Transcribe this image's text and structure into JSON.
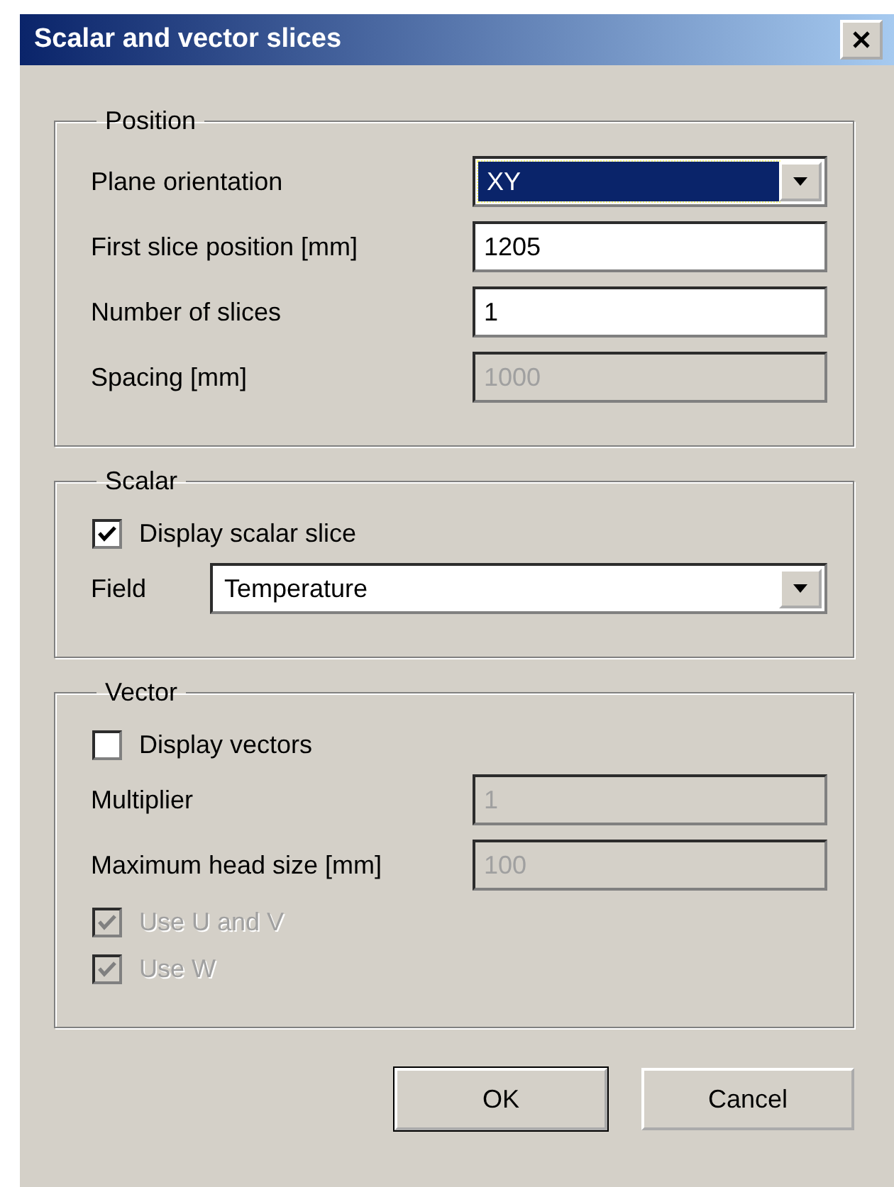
{
  "window": {
    "title": "Scalar and vector slices"
  },
  "sections": [
    {
      "title": "Position",
      "rows": [
        {
          "kind": "combo",
          "label": "Plane orientation",
          "value": "XY",
          "focused": true
        },
        {
          "kind": "field",
          "label": "First slice position [mm]",
          "value": "1205",
          "disabled": false
        },
        {
          "kind": "field",
          "label": "Number of slices",
          "value": "1",
          "disabled": false
        },
        {
          "kind": "field",
          "label": "Spacing [mm]",
          "value": "1000",
          "disabled": true
        }
      ]
    },
    {
      "title": "Scalar",
      "rows": [
        {
          "kind": "checkbox",
          "label": "Display scalar slice",
          "checked": true,
          "disabled": false
        },
        {
          "kind": "wide_combo",
          "label": "Field",
          "value": "Temperature",
          "focused": false
        }
      ]
    },
    {
      "title": "Vector",
      "rows": [
        {
          "kind": "checkbox",
          "label": "Display vectors",
          "checked": false,
          "disabled": false
        },
        {
          "kind": "field",
          "label": "Multiplier",
          "value": "1",
          "disabled": true
        },
        {
          "kind": "field",
          "label": "Maximum head size [mm]",
          "value": "100",
          "disabled": true
        },
        {
          "kind": "checkbox",
          "label": "Use U and V",
          "checked": true,
          "disabled": true
        },
        {
          "kind": "checkbox",
          "label": "Use W",
          "checked": true,
          "disabled": true
        }
      ]
    }
  ],
  "buttons": [
    {
      "label": "OK",
      "default": true
    },
    {
      "label": "Cancel",
      "default": false
    }
  ]
}
